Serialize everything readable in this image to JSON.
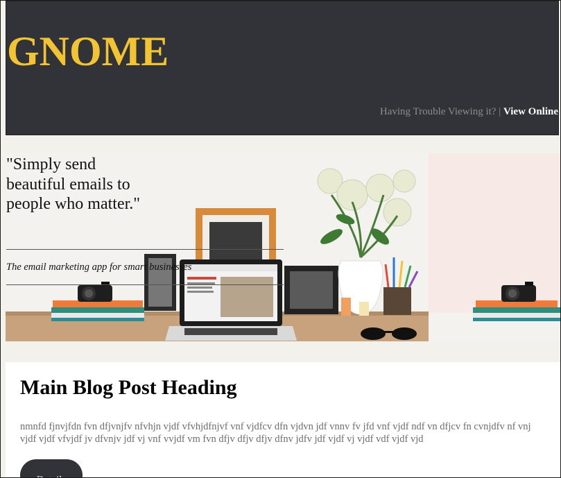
{
  "header": {
    "logo": "GNOME",
    "trouble_text": "Having Trouble Viewing it?",
    "separator": "|",
    "view_online": "View Online",
    "logo_color": "#f2c433",
    "background_color": "#323338"
  },
  "hero": {
    "quote": "\"Simply send beautiful emails to people who matter.\"",
    "tagline": "The email marketing app for smart businesses"
  },
  "post": {
    "title": "Main Blog Post Heading",
    "body": "nmnfd fjnvjfdn fvn dfjvnjfv nfvhjn vjdf vfvhjdfnjvf vnf vjdfcv dfn vjdvn jdf vnnv fv jfd vnf vjdf ndf vn dfjcv fn cvnjdfv nf vnj vjdf vjdf vfvjdf jv dfvnjv jdf vj vnf vvjdf vm fvn dfjv dfjv dfjv dfnv jdfv jdf vjdf vj vjdf vdf vjdf vjd",
    "button_label": "Details"
  }
}
